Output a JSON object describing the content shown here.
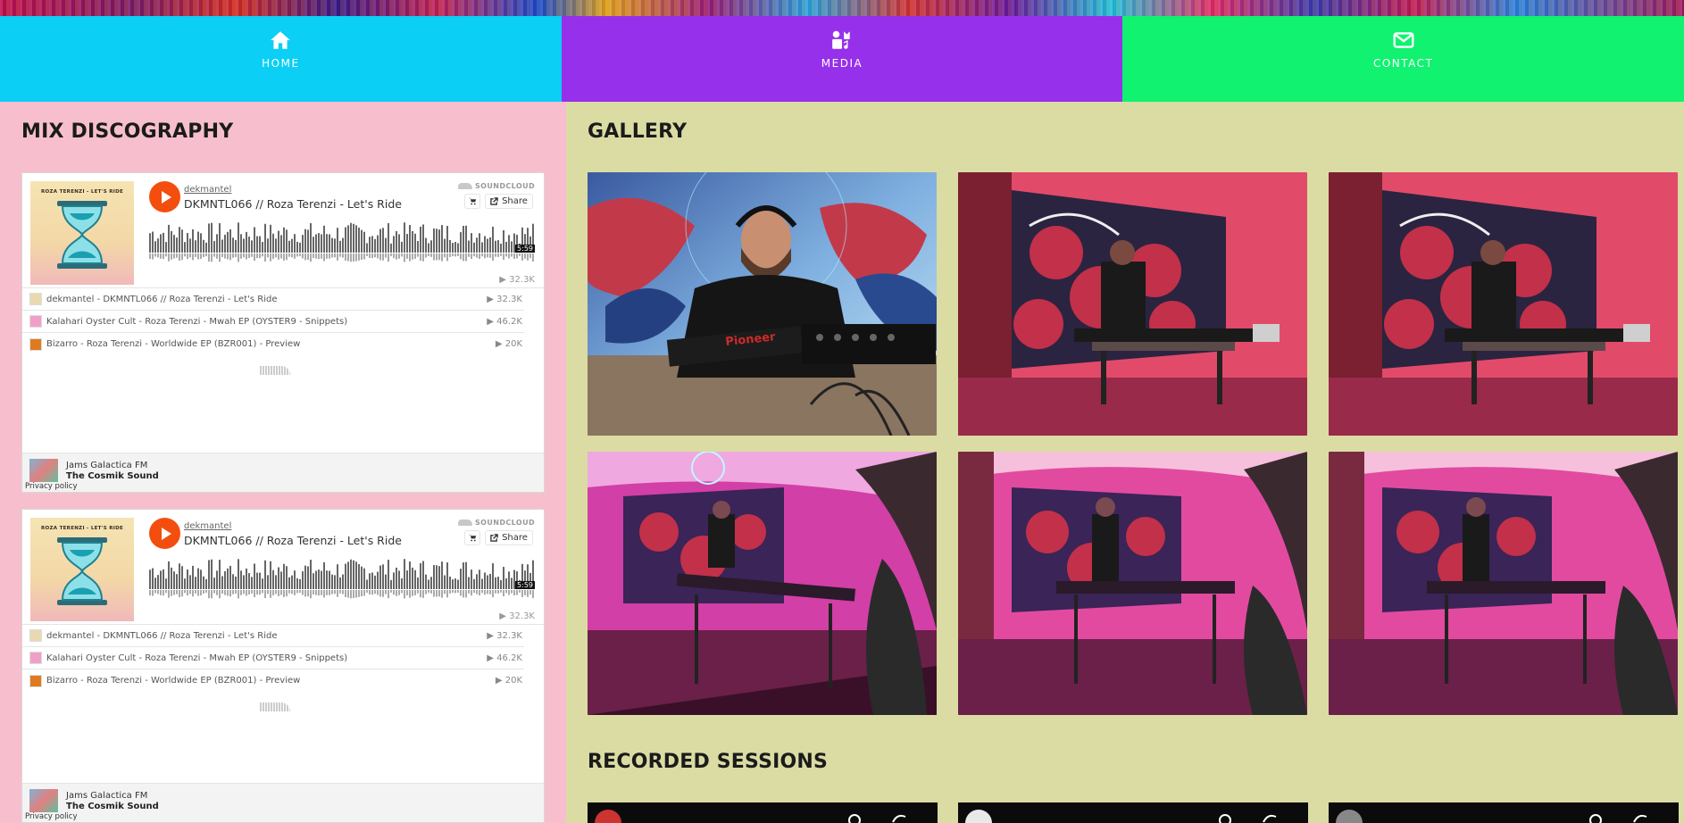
{
  "nav": {
    "items": [
      {
        "label": "HOME",
        "icon": "home-icon",
        "color": "#0ccff5"
      },
      {
        "label": "MEDIA",
        "icon": "media-icon",
        "color": "#9730ea"
      },
      {
        "label": "CONTACT",
        "icon": "envelope-icon",
        "color": "#10f270"
      }
    ]
  },
  "discography": {
    "title": "MIX DISCOGRAPHY",
    "widgets": [
      {
        "art_title": "ROZA TERENZI - LET'S RIDE",
        "user": "dekmantel",
        "track": "DKMNTL066 // Roza Terenzi - Let's Ride",
        "brand": "SOUNDCLOUD",
        "cart_icon": "cart-icon",
        "share_label": "Share",
        "duration": "5:59",
        "plays": "▶ 32.3K",
        "list": [
          {
            "title": "dekmantel - DKMNTL066 // Roza Terenzi - Let's Ride",
            "count": "▶ 32.3K"
          },
          {
            "title": "Kalahari Oyster Cult - Roza Terenzi - Mwah EP (OYSTER9 - Snippets)",
            "count": "▶ 46.2K"
          },
          {
            "title": "Bizarro - Roza Terenzi - Worldwide EP (BZR001) - Preview",
            "count": "▶ 20K"
          }
        ],
        "footer_line1": "Jams Galactica FM",
        "footer_line2": "The Cosmik Sound",
        "privacy": "Privacy policy"
      },
      {
        "art_title": "ROZA TERENZI - LET'S RIDE",
        "user": "dekmantel",
        "track": "DKMNTL066 // Roza Terenzi - Let's Ride",
        "brand": "SOUNDCLOUD",
        "cart_icon": "cart-icon",
        "share_label": "Share",
        "duration": "5:59",
        "plays": "▶ 32.3K",
        "list": [
          {
            "title": "dekmantel - DKMNTL066 // Roza Terenzi - Let's Ride",
            "count": "▶ 32.3K"
          },
          {
            "title": "Kalahari Oyster Cult - Roza Terenzi - Mwah EP (OYSTER9 - Snippets)",
            "count": "▶ 46.2K"
          },
          {
            "title": "Bizarro - Roza Terenzi - Worldwide EP (BZR001) - Preview",
            "count": "▶ 20K"
          }
        ],
        "footer_line1": "Jams Galactica FM",
        "footer_line2": "The Cosmik Sound",
        "privacy": "Privacy policy"
      }
    ]
  },
  "gallery": {
    "title": "GALLERY"
  },
  "sessions": {
    "title": "RECORDED SESSIONS"
  },
  "colors": {
    "left_bg": "#f7bfcd",
    "right_bg": "#dbdca3",
    "soundcloud_orange": "#f34e0e"
  }
}
